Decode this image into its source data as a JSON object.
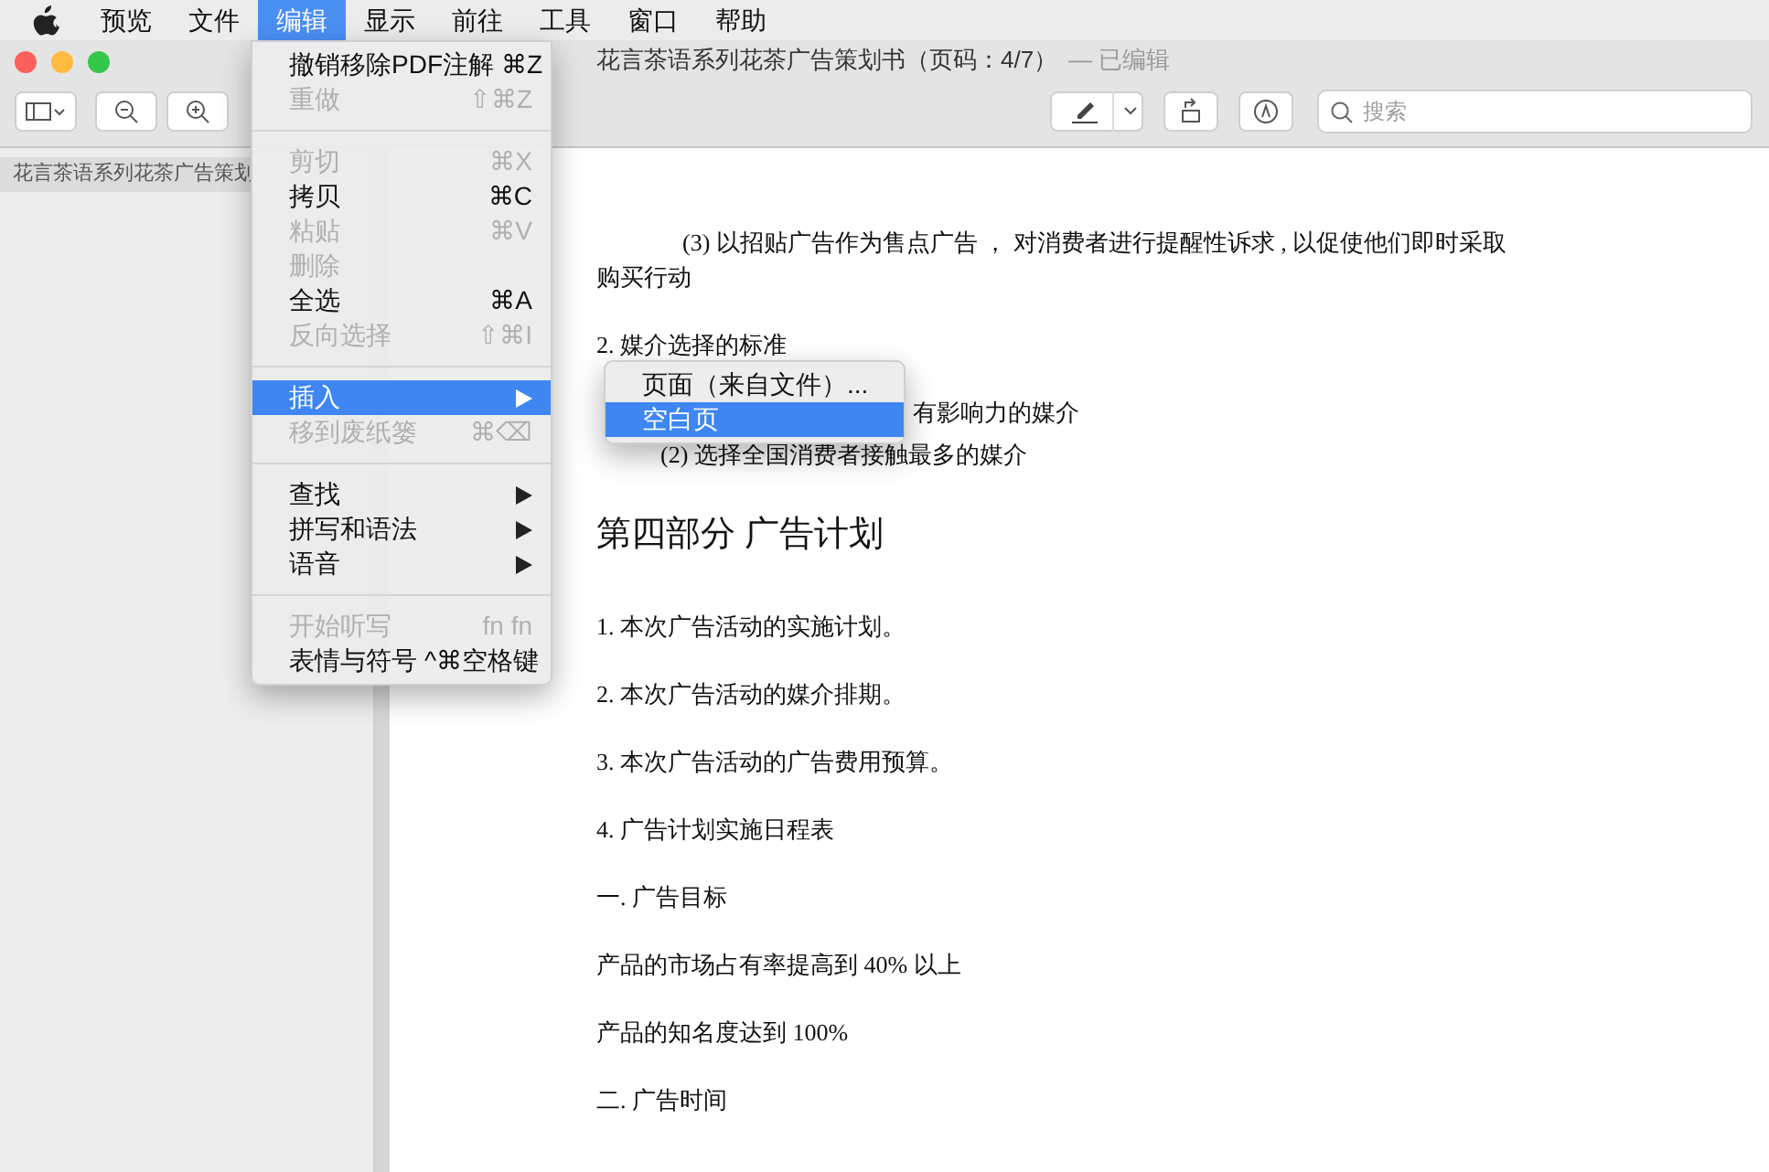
{
  "menubar": {
    "items": [
      {
        "label": "预览",
        "selected": false
      },
      {
        "label": "文件",
        "selected": false
      },
      {
        "label": "编辑",
        "selected": true
      },
      {
        "label": "显示",
        "selected": false
      },
      {
        "label": "前往",
        "selected": false
      },
      {
        "label": "工具",
        "selected": false
      },
      {
        "label": "窗口",
        "selected": false
      },
      {
        "label": "帮助",
        "selected": false
      }
    ]
  },
  "window": {
    "title": "花言茶语系列花茶广告策划书（页码：4/7）",
    "edited": "— 已编辑"
  },
  "search": {
    "placeholder": "搜索"
  },
  "sidebar": {
    "items": [
      {
        "label": "花言茶语系列花茶广告策划",
        "selected": true
      }
    ]
  },
  "document": {
    "paragraphs": [
      {
        "kind": "indented",
        "text": "(3)  以招贴广告作为售点广告 ，  对消费者进行提醒性诉求 , 以促使他们即时采取"
      },
      {
        "kind": "plain",
        "text": "购买行动"
      },
      {
        "kind": "plain",
        "text": "2. 媒介选择的标准"
      },
      {
        "kind": "partial",
        "text": "有影响力的媒介"
      },
      {
        "kind": "sub",
        "text": "(2)  选择全国消费者接触最多的媒介"
      },
      {
        "kind": "heading",
        "text": "第四部分  广告计划"
      },
      {
        "kind": "plain",
        "text": "1.  本次广告活动的实施计划。"
      },
      {
        "kind": "plain",
        "text": "2.  本次广告活动的媒介排期。"
      },
      {
        "kind": "plain",
        "text": "3.  本次广告活动的广告费用预算。"
      },
      {
        "kind": "plain",
        "text": "4.  广告计划实施日程表"
      },
      {
        "kind": "plain",
        "text": "一. 广告目标"
      },
      {
        "kind": "plain",
        "text": "产品的市场占有率提高到  40%  以上"
      },
      {
        "kind": "plain",
        "text": "产品的知名度达到 100%"
      },
      {
        "kind": "plain",
        "text": "二. 广告时间"
      }
    ]
  },
  "edit_menu": {
    "items": [
      {
        "kind": "item",
        "label": "撤销移除PDF注解",
        "shortcut": "⌘Z",
        "disabled": false,
        "selected": false
      },
      {
        "kind": "item",
        "label": "重做",
        "shortcut": "⇧⌘Z",
        "disabled": true,
        "selected": false
      },
      {
        "kind": "separator"
      },
      {
        "kind": "item",
        "label": "剪切",
        "shortcut": "⌘X",
        "disabled": true,
        "selected": false
      },
      {
        "kind": "item",
        "label": "拷贝",
        "shortcut": "⌘C",
        "disabled": false,
        "selected": false
      },
      {
        "kind": "item",
        "label": "粘贴",
        "shortcut": "⌘V",
        "disabled": true,
        "selected": false
      },
      {
        "kind": "item",
        "label": "删除",
        "disabled": true,
        "selected": false
      },
      {
        "kind": "item",
        "label": "全选",
        "shortcut": "⌘A",
        "disabled": false,
        "selected": false
      },
      {
        "kind": "item",
        "label": "反向选择",
        "shortcut": "⇧⌘I",
        "disabled": true,
        "selected": false
      },
      {
        "kind": "separator"
      },
      {
        "kind": "submenu",
        "label": "插入",
        "disabled": false,
        "selected": true
      },
      {
        "kind": "item",
        "label": "移到废纸篓",
        "shortcut": "⌘⌫",
        "disabled": true,
        "selected": false
      },
      {
        "kind": "separator"
      },
      {
        "kind": "submenu",
        "label": "查找",
        "disabled": false,
        "selected": false
      },
      {
        "kind": "submenu",
        "label": "拼写和语法",
        "disabled": false,
        "selected": false
      },
      {
        "kind": "submenu",
        "label": "语音",
        "disabled": false,
        "selected": false
      },
      {
        "kind": "separator"
      },
      {
        "kind": "item",
        "label": "开始听写",
        "shortcut": "fn fn",
        "disabled": true,
        "selected": false
      },
      {
        "kind": "item",
        "label": "表情与符号",
        "shortcut": "^⌘空格键",
        "disabled": false,
        "selected": false
      }
    ]
  },
  "insert_submenu": {
    "items": [
      {
        "label": "页面（来自文件）...",
        "selected": false
      },
      {
        "label": "空白页",
        "selected": true
      }
    ]
  }
}
